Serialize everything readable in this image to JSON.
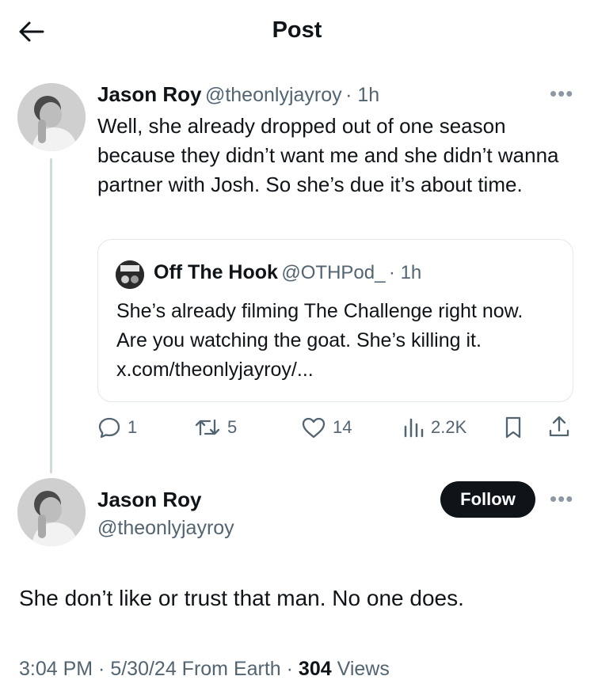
{
  "header": {
    "title": "Post",
    "back_icon": "back-arrow-icon"
  },
  "reply_tweet": {
    "name": "Jason Roy",
    "handle": "@theonlyjayroy",
    "time": "· 1h",
    "text": "Well, she already dropped out of one season because they didn’t want me and she didn’t wanna partner with Josh. So she’s due it’s about time.",
    "quote": {
      "name": "Off The Hook",
      "handle": "@OTHPod_",
      "time": "· 1h",
      "text": "She’s already filming The Challenge right now. Are you watching the goat. She’s killing it. x.com/theonlyjayroy/..."
    },
    "actions": {
      "replies": "1",
      "reposts": "5",
      "likes": "14",
      "views": "2.2K"
    }
  },
  "main_tweet": {
    "name": "Jason Roy",
    "handle": "@theonlyjayroy",
    "follow_label": "Follow",
    "text": "She don’t like or trust that man. No one does.",
    "meta_time": "3:04 PM · 5/30/24 From Earth · ",
    "views_count": "304",
    "views_label": "Views"
  }
}
